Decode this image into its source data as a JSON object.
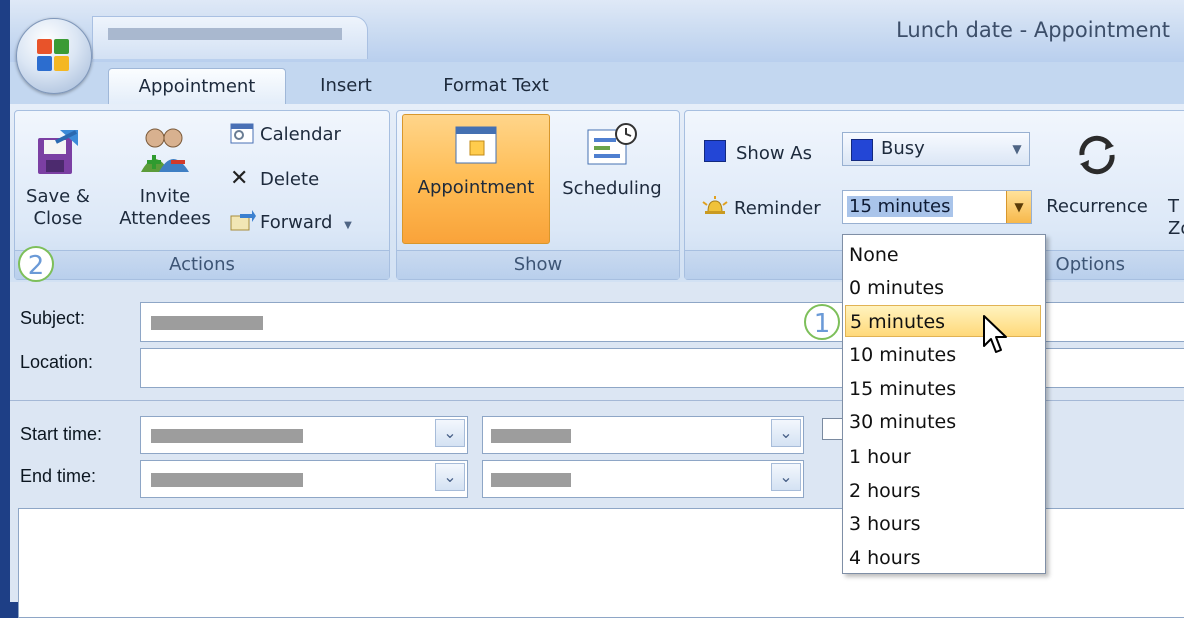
{
  "window": {
    "title": "Lunch date - Appointment"
  },
  "tabs": [
    {
      "label": "Appointment"
    },
    {
      "label": "Insert"
    },
    {
      "label": "Format Text"
    }
  ],
  "ribbon": {
    "actions": {
      "save_close_line1": "Save &",
      "save_close_line2": "Close",
      "invite_line1": "Invite",
      "invite_line2": "Attendees",
      "calendar": "Calendar",
      "delete": "Delete",
      "forward": "Forward",
      "group_label": "Actions"
    },
    "show": {
      "appointment": "Appointment",
      "scheduling": "Scheduling",
      "group_label": "Show"
    },
    "options": {
      "show_as_label": "Show As",
      "show_as_value": "Busy",
      "reminder_label": "Reminder",
      "reminder_value": "15 minutes",
      "recurrence": "Recurrence",
      "time_zones_line1": "T",
      "time_zones_line2": "Zo",
      "group_label": "Options"
    }
  },
  "form": {
    "subject_label": "Subject:",
    "location_label": "Location:",
    "start_time_label": "Start time:",
    "end_time_label": "End time:"
  },
  "reminder_dropdown": {
    "options": [
      "None",
      "0 minutes",
      "5 minutes",
      "10 minutes",
      "15 minutes",
      "30 minutes",
      "1 hour",
      "2 hours",
      "3 hours",
      "4 hours"
    ],
    "highlighted": "5 minutes"
  },
  "callouts": {
    "one": "1",
    "two": "2"
  },
  "colors": {
    "busy": "#2346d6",
    "highlight": "#ffd97a",
    "callout_border": "#7dbf5a",
    "callout_text": "#6b9ad7"
  },
  "icons": [
    "office-button-icon",
    "save-close-icon",
    "invite-attendees-icon",
    "calendar-icon",
    "delete-icon",
    "forward-icon",
    "appointment-icon",
    "scheduling-icon",
    "reminder-bell-icon",
    "recurrence-icon",
    "mouse-cursor-icon"
  ]
}
